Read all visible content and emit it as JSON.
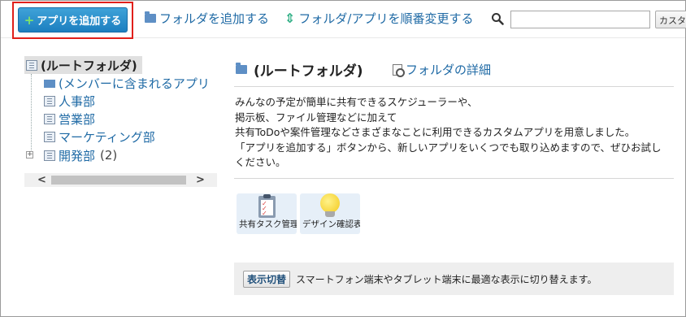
{
  "toolbar": {
    "add_app_label": "アプリを追加する",
    "add_folder_label": "フォルダを追加する",
    "reorder_label": "フォルダ/アプリを順番変更する",
    "search_value": "",
    "custom_button_label": "カスタ"
  },
  "tree": {
    "root_label": "(ルートフォルダ)",
    "items": [
      {
        "label": "(メンバーに含まれるアプリ"
      },
      {
        "label": "人事部"
      },
      {
        "label": "営業部"
      },
      {
        "label": "マーケティング部"
      },
      {
        "label": "開発部",
        "count": "(2)"
      }
    ]
  },
  "main": {
    "title": "(ルートフォルダ)",
    "detail_link": "フォルダの詳細",
    "description": [
      "みんなの予定が簡単に共有できるスケジューラーや、",
      "掲示板、ファイル管理などに加えて",
      "共有ToDoや案件管理などさまざまなことに利用できるカスタムアプリを用意しました。",
      "「アプリを追加する」ボタンから、新しいアプリをいくつでも取り込めますので、ぜひお試し",
      "ください。"
    ],
    "apps": [
      {
        "label": "共有タスク管理",
        "icon": "clipboard-icon"
      },
      {
        "label": "デザイン確認表",
        "icon": "lightbulb-icon"
      }
    ],
    "display_switch": {
      "button_label": "表示切替",
      "text": "スマートフォン端末やタブレット端末に最適な表示に切り替えます。"
    }
  },
  "colors": {
    "accent": "#1c7fc0",
    "link": "#1f6aa5",
    "highlight_box": "#e0201b"
  }
}
